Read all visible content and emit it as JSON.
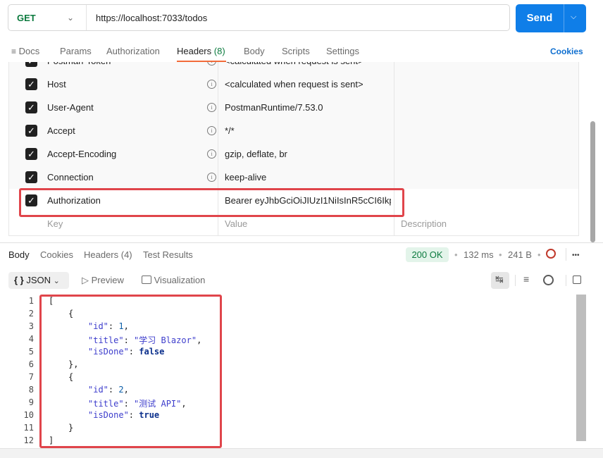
{
  "request": {
    "method": "GET",
    "url": "https://localhost:7033/todos",
    "send_label": "Send"
  },
  "request_tabs": {
    "docs": "Docs",
    "params": "Params",
    "authorization": "Authorization",
    "headers": "Headers",
    "headers_count": "(8)",
    "body": "Body",
    "scripts": "Scripts",
    "settings": "Settings",
    "cookies": "Cookies"
  },
  "headers_table": {
    "rows": [
      {
        "key": "Postman-Token",
        "value": "<calculated when request is sent>"
      },
      {
        "key": "Host",
        "value": "<calculated when request is sent>"
      },
      {
        "key": "User-Agent",
        "value": "PostmanRuntime/7.53.0"
      },
      {
        "key": "Accept",
        "value": "*/*"
      },
      {
        "key": "Accept-Encoding",
        "value": "gzip, deflate, br"
      },
      {
        "key": "Connection",
        "value": "keep-alive"
      },
      {
        "key": "Authorization",
        "value": "Bearer eyJhbGciOiJIUzI1NiIsInR5cCI6Ikp..."
      }
    ],
    "placeholder": {
      "key": "Key",
      "value": "Value",
      "description": "Description"
    }
  },
  "response_tabs": {
    "body": "Body",
    "cookies": "Cookies",
    "headers": "Headers (4)",
    "test_results": "Test Results"
  },
  "response_meta": {
    "status": "200 OK",
    "time": "132 ms",
    "size": "241 B",
    "more": "•••"
  },
  "response_toolbar": {
    "format": "JSON",
    "preview": "Preview",
    "visualization": "Visualization"
  },
  "response_body": {
    "line_numbers": [
      "1",
      "2",
      "3",
      "4",
      "5",
      "6",
      "7",
      "8",
      "9",
      "10",
      "11",
      "12"
    ],
    "items": [
      {
        "id": "1",
        "title": "\"学习 Blazor\"",
        "isDone": "false"
      },
      {
        "id": "2",
        "title": "\"测试 API\"",
        "isDone": "true"
      }
    ]
  },
  "colors": {
    "send": "#0f7ee8",
    "method": "#0b7a3e",
    "status_bg": "#e3f4ea",
    "highlight": "#e0454b",
    "tab_underline": "#f26b3a"
  }
}
